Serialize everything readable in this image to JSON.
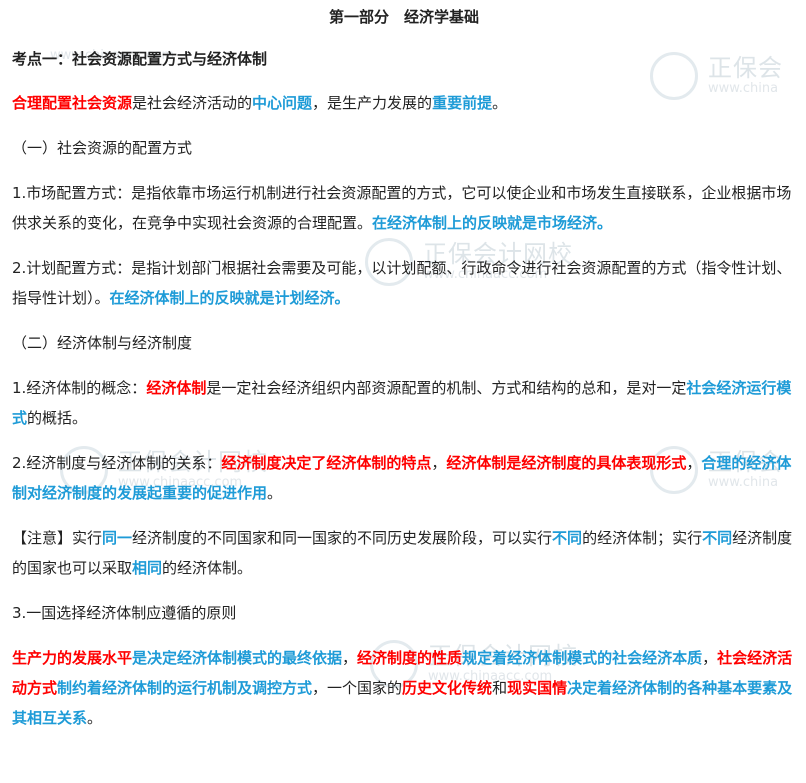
{
  "watermark": {
    "brand": "正保会计网校",
    "brand_short": "正保会",
    "url": "www.chinaacc.com",
    "url_short": "www.china"
  },
  "title": "第一部分　经济学基础",
  "section": "考点一：社会资源配置方式与经济体制",
  "p1": {
    "s1": "合理配置社会资源",
    "s2": "是社会经济活动的",
    "s3": "中心问题",
    "s4": "，是生产力发展的",
    "s5": "重要前提",
    "s6": "。"
  },
  "h1": "（一）社会资源的配置方式",
  "p2": {
    "s1": "1.市场配置方式：是指依靠市场运行机制进行社会资源配置的方式，它可以使企业和市场发生直接联系，企业根据市场供求关系的变化，在竞争中实现社会资源的合理配置。",
    "s2": "在经济体制上的反映就是市场经济。"
  },
  "p3": {
    "s1": "2.计划配置方式：是指计划部门根据社会需要及可能，以计划配额、行政命令进行社会资源配置的方式（指令性计划、指导性计划）。",
    "s2": "在经济体制上的反映就是计划经济。"
  },
  "h2": "（二）经济体制与经济制度",
  "p4": {
    "s1": "1.经济体制的概念：",
    "s2": "经济体制",
    "s3": "是一定社会经济组织内部资源配置的机制、方式和结构的总和，是对一定",
    "s4": "社会经济运行模式",
    "s5": "的概括。"
  },
  "p5": {
    "s1": "2.经济制度与经济体制的关系：",
    "s2": "经济制度决定了经济体制的特点",
    "s3": "，",
    "s4": "经济体制是经济制度的具体表现形式",
    "s5": "，",
    "s6": "合理的经济体制对经济制度的发展起重要的促进作用",
    "s7": "。"
  },
  "p6": {
    "s1": "【注意】实行",
    "s2": "同一",
    "s3": "经济制度的不同国家和同一国家的不同历史发展阶段，可以实行",
    "s4": "不同",
    "s5": "的经济体制；实行",
    "s6": "不同",
    "s7": "经济制度的国家也可以采取",
    "s8": "相同",
    "s9": "的经济体制。"
  },
  "p7": "3.一国选择经济体制应遵循的原则",
  "p8": {
    "s1": "生产力的发展水平",
    "s2": "是决定经济体制模式的最终依据",
    "s3": "，",
    "s4": "经济制度的性质",
    "s5": "规定着经济体制模式的社会经济本质",
    "s6": "，",
    "s7": "社会经济活动方式",
    "s8": "制约着经济体制的运行机制及调控方式",
    "s9": "，一个国家的",
    "s10": "历史文化传统",
    "s11": "和",
    "s12": "现实国情",
    "s13": "决定着经济体制的各种基本要素及其相互关系",
    "s14": "。"
  },
  "colors": {
    "red": "#ff0000",
    "blue": "#1e9bd7",
    "text": "#222222"
  }
}
